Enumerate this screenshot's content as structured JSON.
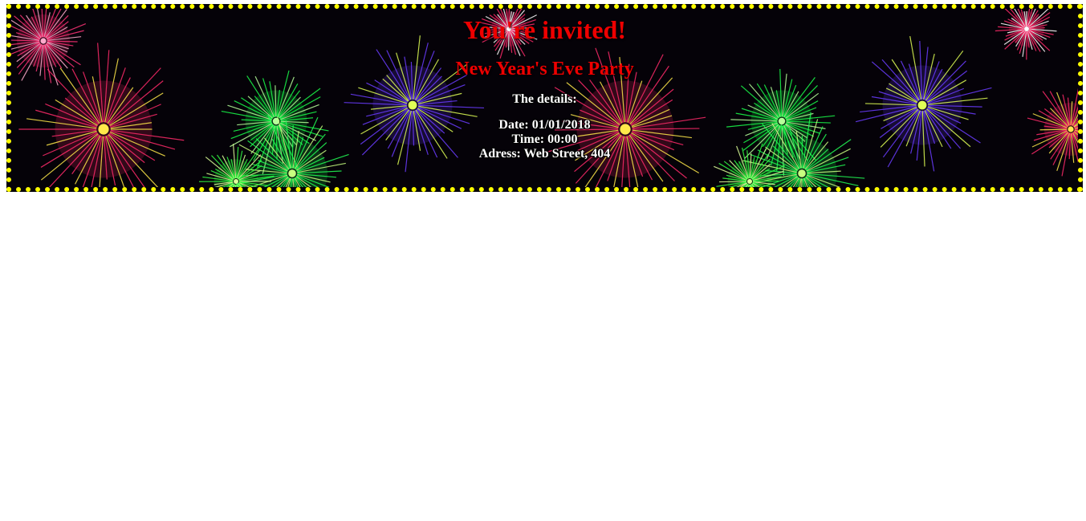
{
  "invitation": {
    "title": "You're invited!",
    "event_name": "New Year's Eve Party",
    "details_heading": "The details:",
    "date_line": "Date: 01/01/2018",
    "time_line": "Time: 00:00",
    "address_line": "Adress: Web Street, 404"
  },
  "colors": {
    "title": "#ee0000",
    "border": "#ffff00",
    "details_text": "#ffffff",
    "background": "#050208"
  },
  "background_image": "fireworks"
}
